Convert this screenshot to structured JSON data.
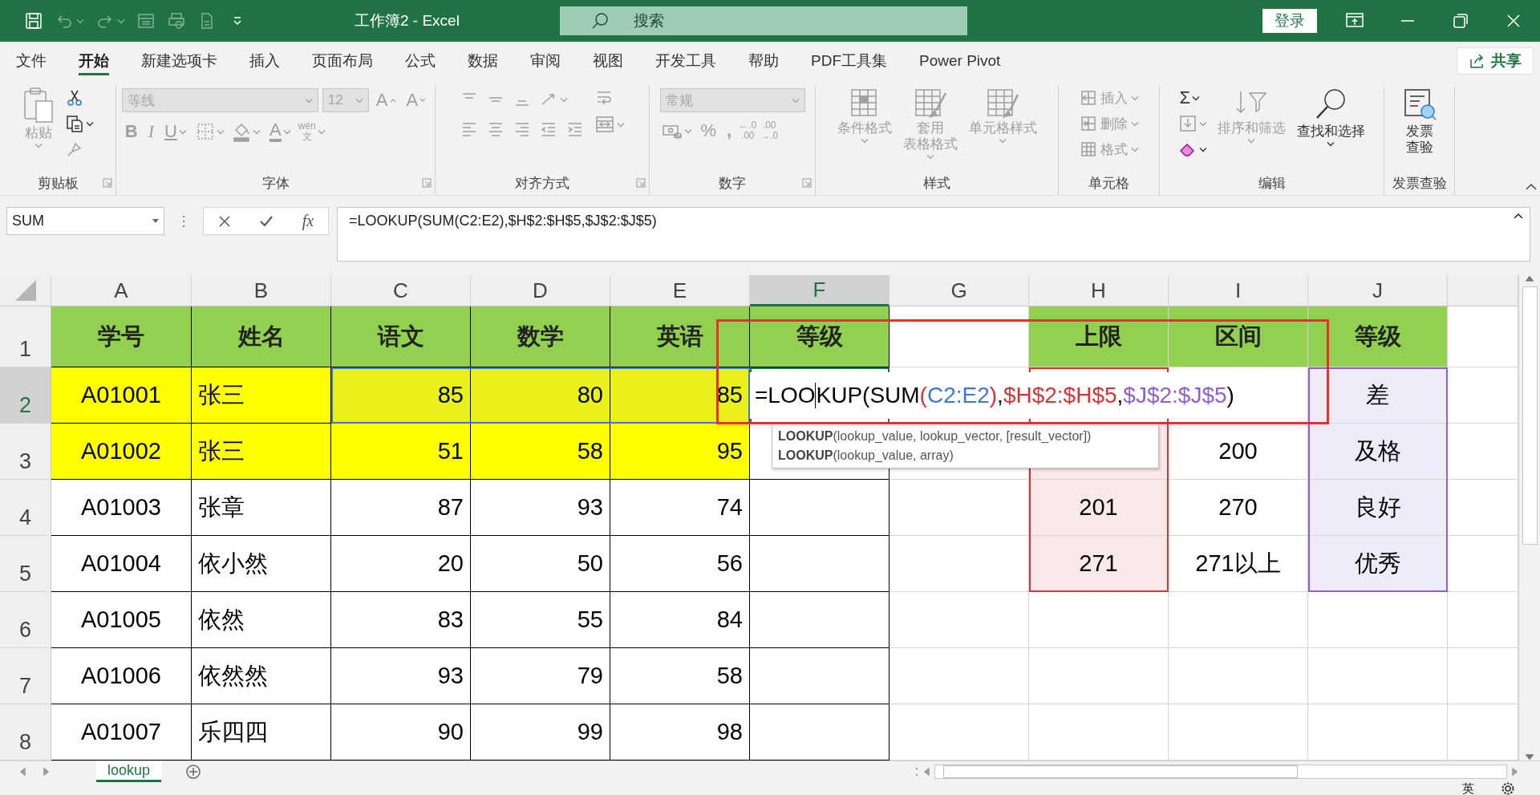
{
  "window": {
    "title": "工作簿2 - Excel",
    "search": {
      "placeholder": "搜索"
    },
    "sign_in": "登录"
  },
  "quick_access": [
    {
      "disabled": false
    },
    {
      "disabled": true
    },
    {
      "disabled": true
    },
    {
      "disabled": true
    },
    {
      "disabled": true
    },
    {
      "disabled": true
    },
    {
      "disabled": false
    }
  ],
  "menu_tabs": [
    {
      "label": "文件",
      "selected": false
    },
    {
      "label": "开始",
      "selected": true
    },
    {
      "label": "新建选项卡",
      "selected": false
    },
    {
      "label": "插入",
      "selected": false
    },
    {
      "label": "页面布局",
      "selected": false
    },
    {
      "label": "公式",
      "selected": false
    },
    {
      "label": "数据",
      "selected": false
    },
    {
      "label": "审阅",
      "selected": false
    },
    {
      "label": "视图",
      "selected": false
    },
    {
      "label": "开发工具",
      "selected": false
    },
    {
      "label": "帮助",
      "selected": false
    },
    {
      "label": "PDF工具集",
      "selected": false
    },
    {
      "label": "Power Pivot",
      "selected": false
    }
  ],
  "share": "共享",
  "ribbon": {
    "groups": [
      {
        "label": "剪贴板",
        "launcher": true,
        "sections": [
          {
            "kind": "big",
            "lines": [
              "粘贴"
            ],
            "caret": true,
            "disabled": true
          },
          {
            "kind": "column",
            "items": [
              {
                "kind": "icon",
                "disabled": false
              },
              {
                "kind": "icon",
                "caret": true,
                "disabled": false
              },
              {
                "kind": "icon",
                "disabled": true
              }
            ]
          }
        ]
      },
      {
        "label": "字体",
        "launcher": true,
        "sections": [
          {
            "kind": "rows",
            "bands": [
              {
                "items": [
                  {
                    "kind": "select",
                    "value": "等线",
                    "disabled": true
                  },
                  {
                    "kind": "select",
                    "value": "12",
                    "disabled": true
                  },
                  {
                    "kind": "grow",
                    "text": "A",
                    "disabled": true
                  },
                  {
                    "kind": "shrink",
                    "text": "A",
                    "disabled": true
                  }
                ]
              },
              {
                "items": [
                  {
                    "kind": "bold",
                    "text": "B",
                    "disabled": true
                  },
                  {
                    "kind": "italic",
                    "text": "I",
                    "disabled": true
                  },
                  {
                    "kind": "underline",
                    "text": "U",
                    "caret": true,
                    "disabled": true
                  },
                  {
                    "kind": "icon",
                    "caret": true,
                    "disabled": true
                  },
                  {
                    "kind": "icon",
                    "caret": true,
                    "disabled": true
                  },
                  {
                    "kind": "glyph",
                    "text": "A",
                    "bar": true,
                    "caret": true,
                    "disabled": true
                  },
                  {
                    "kind": "stack",
                    "texts": [
                      "wén",
                      "文"
                    ],
                    "caret": true,
                    "disabled": true
                  }
                ]
              }
            ]
          }
        ]
      },
      {
        "label": "对齐方式",
        "launcher": true,
        "sections": [
          {
            "kind": "rows",
            "bands": [
              {
                "items": [
                  {
                    "kind": "icon",
                    "disabled": true
                  },
                  {
                    "kind": "icon",
                    "disabled": true
                  },
                  {
                    "kind": "icon",
                    "disabled": true
                  },
                  {
                    "kind": "icon",
                    "caret": true,
                    "disabled": true
                  }
                ]
              },
              {
                "items": [
                  {
                    "kind": "icon",
                    "disabled": true
                  },
                  {
                    "kind": "icon",
                    "disabled": true
                  },
                  {
                    "kind": "icon",
                    "disabled": true
                  },
                  {
                    "kind": "icon",
                    "disabled": true
                  },
                  {
                    "kind": "icon",
                    "disabled": true
                  }
                ]
              }
            ]
          },
          {
            "kind": "column",
            "items": [
              {
                "kind": "icon",
                "disabled": true
              },
              {
                "kind": "icon",
                "caret": true,
                "disabled": true
              }
            ]
          }
        ]
      },
      {
        "label": "数字",
        "launcher": true,
        "sections": [
          {
            "kind": "rows",
            "bands": [
              {
                "items": [
                  {
                    "kind": "select",
                    "value": "常规",
                    "disabled": true
                  }
                ]
              },
              {
                "items": [
                  {
                    "kind": "icon",
                    "caret": true,
                    "disabled": true
                  },
                  {
                    "kind": "glyph",
                    "text": "%",
                    "disabled": true
                  },
                  {
                    "kind": "bold",
                    "text": ",",
                    "disabled": true
                  },
                  {
                    "kind": "stack",
                    "texts": [
                      "←.0",
                      ".00"
                    ],
                    "disabled": true
                  },
                  {
                    "kind": "stack",
                    "texts": [
                      ".00",
                      "→.0"
                    ],
                    "disabled": true
                  }
                ]
              }
            ]
          }
        ]
      },
      {
        "label": "样式",
        "sections": [
          {
            "kind": "big",
            "lines": [
              "条件格式"
            ],
            "caret": true,
            "disabled": true
          },
          {
            "kind": "big",
            "lines": [
              "套用",
              "表格格式"
            ],
            "caret": true,
            "disabled": true
          },
          {
            "kind": "big",
            "lines": [
              "单元格样式"
            ],
            "caret": true,
            "disabled": true
          }
        ]
      },
      {
        "label": "单元格",
        "sections": [
          {
            "kind": "column",
            "items": [
              {
                "kind": "small",
                "label": "插入",
                "caret": true,
                "disabled": true
              },
              {
                "kind": "small",
                "label": "删除",
                "caret": true,
                "disabled": true
              },
              {
                "kind": "small",
                "label": "格式",
                "caret": true,
                "disabled": true
              }
            ]
          }
        ]
      },
      {
        "label": "编辑",
        "sections": [
          {
            "kind": "column",
            "items": [
              {
                "kind": "glyph",
                "text": "Σ",
                "caret": true,
                "disabled": false
              },
              {
                "kind": "icon",
                "caret": true,
                "disabled": true
              },
              {
                "kind": "icon",
                "caret": true,
                "disabled": false
              }
            ]
          },
          {
            "kind": "big",
            "lines": [
              "排序和筛选"
            ],
            "caret": true,
            "disabled": true
          },
          {
            "kind": "big",
            "lines": [
              "查找和选择"
            ],
            "caret": true,
            "disabled": false
          }
        ]
      },
      {
        "label": "发票查验",
        "sections": [
          {
            "kind": "big",
            "lines": [
              "发票",
              "查验"
            ],
            "disabled": false
          }
        ]
      }
    ]
  },
  "formula_bar": {
    "name_box": "SUM",
    "fx": "fx",
    "formula": "=LOOKUP(SUM(C2:E2),$H$2:$H$5,$J$2:$J$5)"
  },
  "sheet": {
    "columns": [
      {
        "label": "A",
        "selected": false
      },
      {
        "label": "B",
        "selected": false
      },
      {
        "label": "C",
        "selected": false
      },
      {
        "label": "D",
        "selected": false
      },
      {
        "label": "E",
        "selected": false
      },
      {
        "label": "F",
        "selected": true
      },
      {
        "label": "G",
        "selected": false
      },
      {
        "label": "H",
        "selected": false
      },
      {
        "label": "I",
        "selected": false
      },
      {
        "label": "J",
        "selected": false
      }
    ],
    "rows": [
      {
        "label": "1",
        "selected": false,
        "kind": "header",
        "cells": [
          {
            "text": "学号",
            "color": "#92d050"
          },
          {
            "text": "姓名",
            "color": "#92d050"
          },
          {
            "text": "语文",
            "color": "#92d050"
          },
          {
            "text": "数学",
            "color": "#92d050"
          },
          {
            "text": "英语",
            "color": "#92d050"
          },
          {
            "text": "等级",
            "color": "#92d050"
          },
          {},
          {
            "text": "上限",
            "color": "#92d050"
          },
          {
            "text": "区间",
            "color": "#92d050"
          },
          {
            "text": "等级",
            "color": "#92d050"
          }
        ]
      },
      {
        "label": "2",
        "selected": true,
        "kind": "data",
        "cells": [
          {
            "text": "A01001",
            "color": "#ffff00"
          },
          {
            "text": "张三",
            "color": "#ffff00"
          },
          {
            "text": "85",
            "color": "#e9f01a"
          },
          {
            "text": "80",
            "color": "#e9f01a"
          },
          {
            "text": "85",
            "color": "#e9f01a"
          },
          {},
          {},
          {},
          {},
          {
            "text": "差",
            "color": "#efeaf8"
          }
        ]
      },
      {
        "label": "3",
        "selected": false,
        "kind": "data",
        "cells": [
          {
            "text": "A01002",
            "color": "#ffff00"
          },
          {
            "text": "张三",
            "color": "#ffff00"
          },
          {
            "text": "51",
            "color": "#ffff00"
          },
          {
            "text": "58",
            "color": "#ffff00"
          },
          {
            "text": "95",
            "color": "#ffff00"
          },
          {},
          {},
          {
            "color": "#fbe8e8"
          },
          {
            "text": "200"
          },
          {
            "text": "及格",
            "color": "#efeaf8"
          }
        ]
      },
      {
        "label": "4",
        "selected": false,
        "kind": "data",
        "cells": [
          {
            "text": "A01003"
          },
          {
            "text": "张章"
          },
          {
            "text": "87"
          },
          {
            "text": "93"
          },
          {
            "text": "74"
          },
          {},
          {},
          {
            "text": "201",
            "color": "#fbe8e8"
          },
          {
            "text": "270"
          },
          {
            "text": "良好",
            "color": "#efeaf8"
          }
        ]
      },
      {
        "label": "5",
        "selected": false,
        "kind": "data",
        "cells": [
          {
            "text": "A01004"
          },
          {
            "text": "依小然"
          },
          {
            "text": "20"
          },
          {
            "text": "50"
          },
          {
            "text": "56"
          },
          {},
          {},
          {
            "text": "271",
            "color": "#fbe8e8"
          },
          {
            "text": "271以上"
          },
          {
            "text": "优秀",
            "color": "#efeaf8"
          }
        ]
      },
      {
        "label": "6",
        "selected": false,
        "kind": "data",
        "cells": [
          {
            "text": "A01005"
          },
          {
            "text": "依然"
          },
          {
            "text": "83"
          },
          {
            "text": "55"
          },
          {
            "text": "84"
          },
          {},
          {},
          {},
          {},
          {}
        ]
      },
      {
        "label": "7",
        "selected": false,
        "kind": "data",
        "cells": [
          {
            "text": "A01006"
          },
          {
            "text": "依然然"
          },
          {
            "text": "93"
          },
          {
            "text": "79"
          },
          {
            "text": "58"
          },
          {},
          {},
          {},
          {},
          {}
        ]
      },
      {
        "label": "8",
        "selected": false,
        "kind": "data",
        "cells": [
          {
            "text": "A01007"
          },
          {
            "text": "乐四四"
          },
          {
            "text": "90"
          },
          {
            "text": "99"
          },
          {
            "text": "98"
          },
          {},
          {},
          {},
          {},
          {}
        ]
      }
    ],
    "editing": {
      "parts": [
        {
          "text": "=LOO",
          "cursor_after": true
        },
        {
          "text": "KUP(SUM"
        },
        {
          "text": "(",
          "color": "#d13438"
        },
        {
          "text": "C2:E2",
          "color": "#3f78d4"
        },
        {
          "text": ")",
          "color": "#d13438"
        },
        {
          "text": ","
        },
        {
          "text": "$H$2:$H$5",
          "color": "#d13438"
        },
        {
          "text": ","
        },
        {
          "text": "$J$2:$J$5",
          "color": "#8f5fcc"
        },
        {
          "text": ")"
        }
      ]
    },
    "tooltip": {
      "lines": [
        "**LOOKUP**(lookup_value, lookup_vector, [result_vector])",
        "**LOOKUP**(lookup_value, array)"
      ]
    },
    "callout_frame": true
  },
  "sheet_tabs": [
    {
      "label": "lookup",
      "selected": true
    }
  ],
  "status_bar": {
    "input_mode": "英"
  }
}
